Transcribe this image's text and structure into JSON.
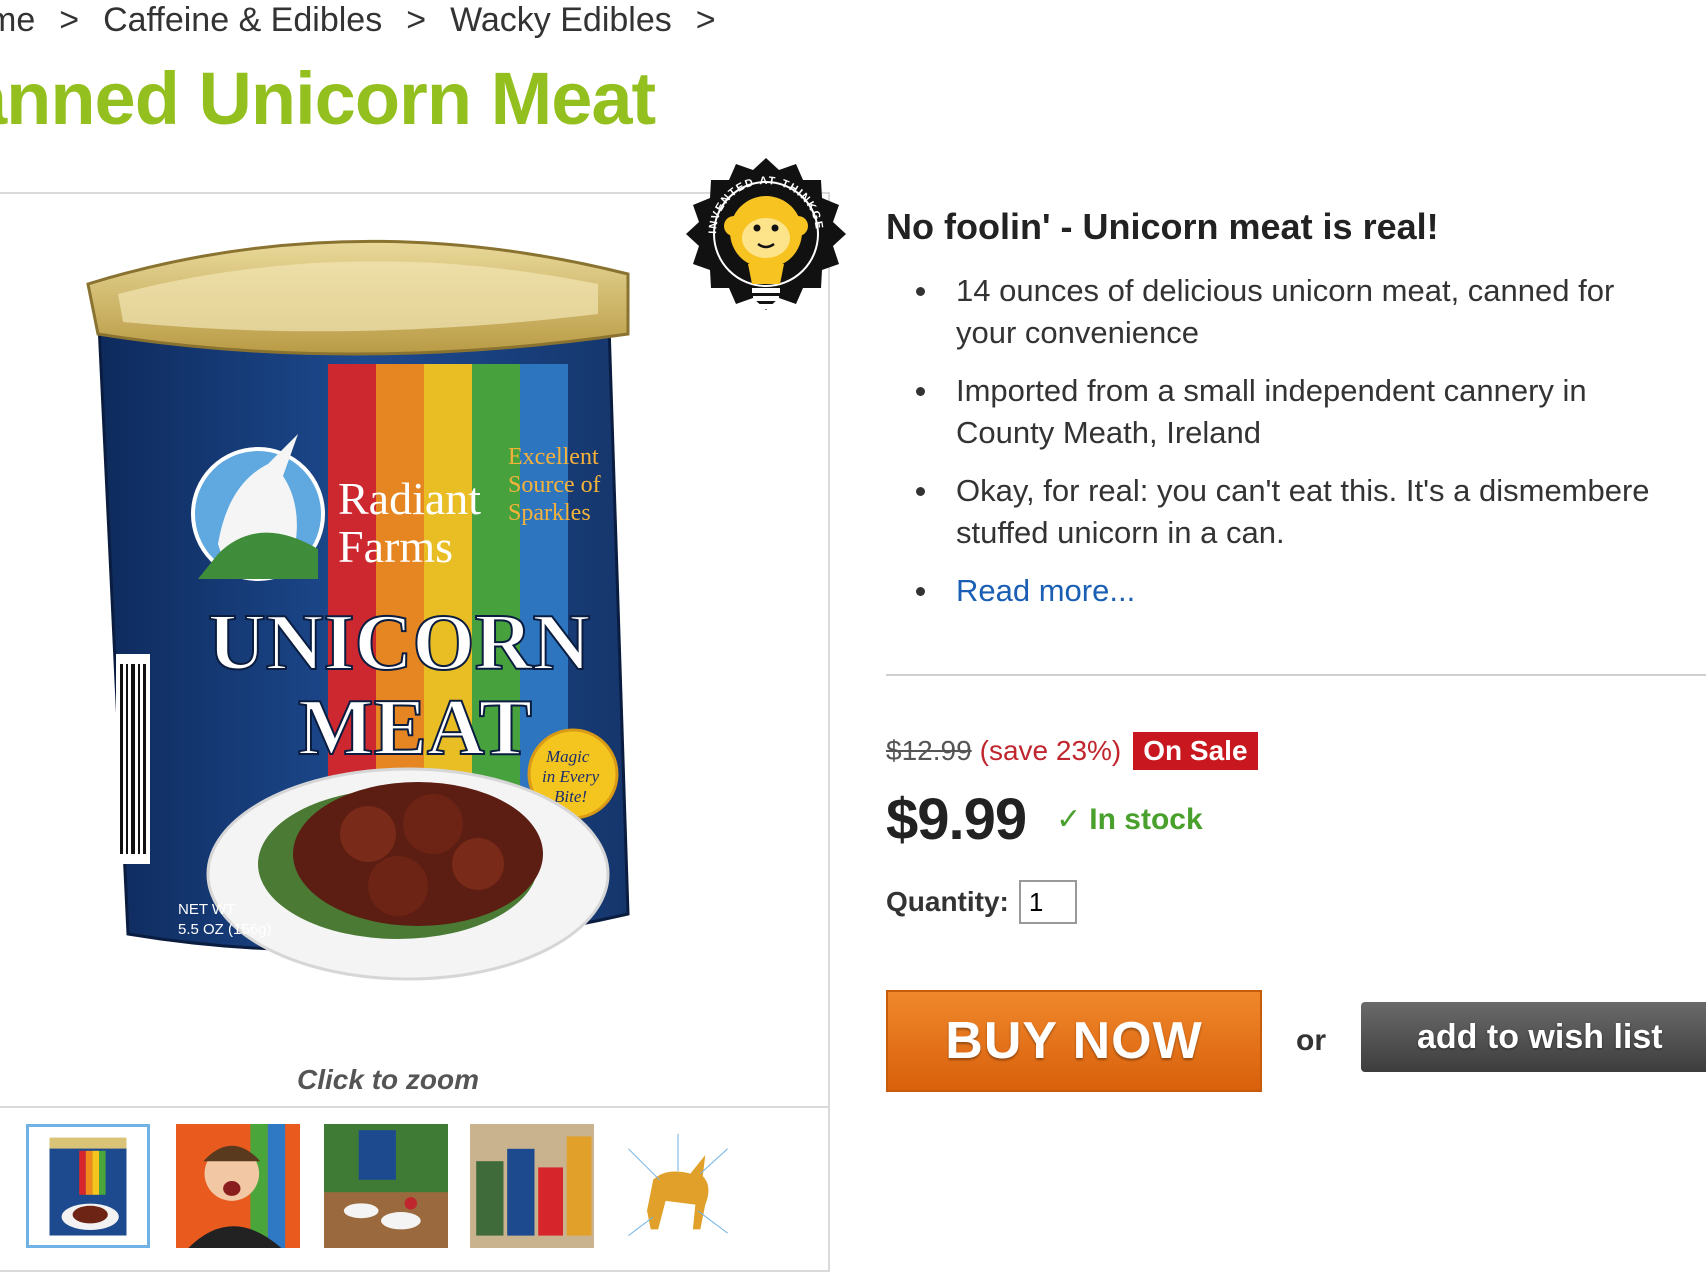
{
  "breadcrumb": {
    "items": [
      "me",
      "Caffeine & Edibles",
      "Wacky Edibles"
    ],
    "separator": ">"
  },
  "product": {
    "title": "anned Unicorn Meat",
    "tagline": "No foolin' - Unicorn meat is real!",
    "features": [
      "14 ounces of delicious unicorn meat, canned for",
      "your convenience",
      "Imported from a small independent cannery in",
      "County Meath, Ireland",
      "Okay, for real: you can't eat this. It's a dismembere",
      "stuffed unicorn in a can."
    ],
    "read_more": "Read more..."
  },
  "image": {
    "zoom_caption": "Click to zoom",
    "can_text": {
      "brand_line1": "Radiant",
      "brand_line2": "Farms",
      "name_line1": "UNICORN",
      "name_line2": "MEAT",
      "source_line1": "Excellent",
      "source_line2": "Source of",
      "source_line3": "Sparkles",
      "magic_line1": "Magic",
      "magic_line2": "in Every",
      "magic_line3": "Bite!",
      "net_wt_line1": "NET WT",
      "net_wt_line2": "5.5 OZ (156g)"
    },
    "thumbnails": [
      "thumb-can",
      "thumb-person",
      "thumb-plush",
      "thumb-cans",
      "thumb-diagram"
    ],
    "active_thumbnail": 0
  },
  "badge": {
    "text": "INVENTED AT THINKGEEK",
    "icon": "lightbulb-monkey-icon"
  },
  "pricing": {
    "old_price": "$12.99",
    "savings": "(save 23%)",
    "sale_label": "On Sale",
    "current_price": "$9.99",
    "stock_status": "In stock",
    "stock_icon": "✓"
  },
  "purchase": {
    "quantity_label": "Quantity:",
    "quantity_value": "1",
    "buy_label": "BUY NOW",
    "or_label": "or",
    "wishlist_label": "add to wish list"
  },
  "colors": {
    "title_green": "#93c01f",
    "sale_red": "#c8171e",
    "stock_green": "#4aa02c",
    "buy_orange": "#e2701b",
    "link_blue": "#1a5fb4"
  }
}
